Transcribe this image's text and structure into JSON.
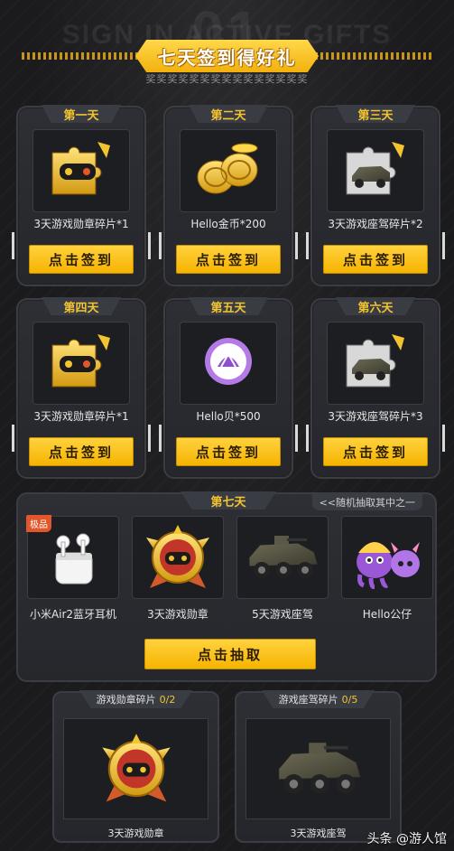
{
  "header": {
    "bg_word": "SIGN IN ACTIVE GIFTS",
    "bg_number": "01",
    "title": "七天签到得好礼",
    "subline": "奖奖奖奖奖奖奖奖奖奖奖奖奖奖奖"
  },
  "days": [
    {
      "day": "第一天",
      "label": "3天游戏勋章碎片*1",
      "button": "点击签到",
      "icon": "badge-puzzle-icon"
    },
    {
      "day": "第二天",
      "label": "Hello金币*200",
      "button": "点击签到",
      "icon": "gold-coins-icon"
    },
    {
      "day": "第三天",
      "label": "3天游戏座驾碎片*2",
      "button": "点击签到",
      "icon": "vehicle-puzzle-icon"
    },
    {
      "day": "第四天",
      "label": "3天游戏勋章碎片*1",
      "button": "点击签到",
      "icon": "badge-puzzle-icon"
    },
    {
      "day": "第五天",
      "label": "Hello贝*500",
      "button": "点击签到",
      "icon": "shell-icon"
    },
    {
      "day": "第六天",
      "label": "3天游戏座驾碎片*3",
      "button": "点击签到",
      "icon": "vehicle-puzzle-icon"
    }
  ],
  "day7": {
    "day": "第七天",
    "hint": "<<随机抽取其中之一",
    "items": [
      {
        "label": "小米Air2蓝牙耳机",
        "badge": "极品",
        "icon": "earbuds-icon"
      },
      {
        "label": "3天游戏勋章",
        "icon": "medal-icon"
      },
      {
        "label": "5天游戏座驾",
        "icon": "armored-vehicle-icon"
      },
      {
        "label": "Hello公仔",
        "icon": "octopus-plush-icon"
      }
    ],
    "button": "点击抽取"
  },
  "fragments": [
    {
      "title": "游戏勋章碎片",
      "count": "0/2",
      "label": "3天游戏勋章",
      "icon": "medal-icon"
    },
    {
      "title": "游戏座驾碎片",
      "count": "0/5",
      "label": "3天游戏座驾",
      "icon": "armored-vehicle-icon"
    }
  ],
  "watermark": "头条 @游人馆",
  "colors": {
    "accent": "#f6b400",
    "day_label": "#f4c430",
    "background": "#1c1c1e"
  }
}
